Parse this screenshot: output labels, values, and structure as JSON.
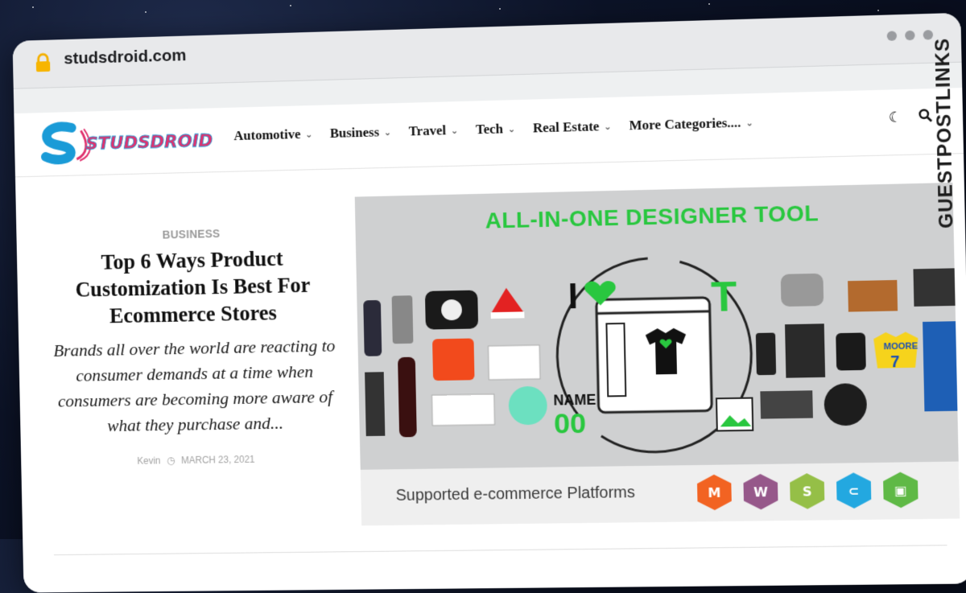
{
  "browser": {
    "url": "studsdroid.com"
  },
  "site": {
    "logo_text": "STUDSDROID",
    "nav": [
      {
        "label": "Automotive"
      },
      {
        "label": "Business"
      },
      {
        "label": "Travel"
      },
      {
        "label": "Tech"
      },
      {
        "label": "Real Estate"
      },
      {
        "label": "More Categories...."
      }
    ]
  },
  "article": {
    "category": "BUSINESS",
    "title": "Top 6 Ways Product Customization Is Best For Ecommerce Stores",
    "excerpt": "Brands all over the world are reacting to consumer demands at a time when consumers are becoming more aware of what they purchase and...",
    "author": "Kevin",
    "date": "MARCH 23, 2021"
  },
  "hero": {
    "headline": "ALL-IN-ONE DESIGNER TOOL",
    "name_label": "NAME",
    "name_number": "00",
    "jersey_name": "MOORE",
    "jersey_number": "7",
    "platforms_label": "Supported e-commerce Platforms",
    "platforms": [
      "magento-icon",
      "woocommerce-icon",
      "shopify-icon",
      "opencart-icon",
      "shopify-bag-icon"
    ]
  },
  "watermark": {
    "text": "GUESTPOSTLINKS"
  },
  "colors": {
    "accent_green": "#29c73f",
    "logo_blue": "#1a9bd7",
    "logo_pink": "#e0326e"
  }
}
